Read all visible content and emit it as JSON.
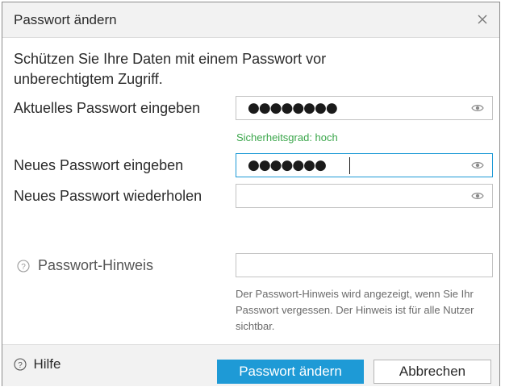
{
  "dialog": {
    "title": "Passwort ändern",
    "close_icon": "close-icon",
    "intro": "Schützen Sie Ihre Daten mit einem Passwort vor unberechtigtem Zugriff."
  },
  "fields": {
    "current": {
      "label": "Aktuelles Passwort eingeben",
      "value": "●●●●●●●●",
      "toggle_icon": "eye-icon"
    },
    "strength": "Sicherheitsgrad: hoch",
    "new": {
      "label": "Neues Passwort eingeben",
      "value": "●●●●●●●",
      "toggle_icon": "eye-icon"
    },
    "repeat": {
      "label": "Neues Passwort wiederholen",
      "value": "",
      "toggle_icon": "eye-icon"
    },
    "hint": {
      "icon": "question-circle-icon",
      "label": "Passwort-Hinweis",
      "value": "",
      "description": "Der Passwort-Hinweis wird angezeigt, wenn Sie Ihr Passwort vergessen. Der Hinweis ist für alle Nutzer sichtbar."
    }
  },
  "footer": {
    "help_icon": "question-circle-icon",
    "help_label": "Hilfe",
    "confirm_label": "Passwort ändern",
    "cancel_label": "Abbrechen"
  },
  "colors": {
    "accent": "#1e9ad6",
    "strength_ok": "#3aa64a",
    "chrome": "#f2f2f2"
  }
}
